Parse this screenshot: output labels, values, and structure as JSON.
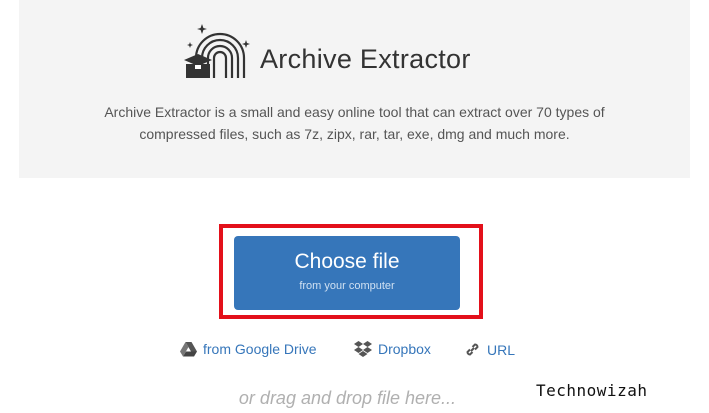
{
  "header": {
    "app_title": "Archive Extractor",
    "description_line1": "Archive Extractor is a small and easy online tool that can extract over 70 types of",
    "description_line2": "compressed files, such as 7z, zipx, rar, tar, exe, dmg and much more.",
    "logo_icon": "rainbow-box-icon"
  },
  "upload": {
    "choose_label": "Choose file",
    "choose_sublabel": "from your computer",
    "highlight_color": "#e3101a",
    "button_color": "#3676ba"
  },
  "sources": [
    {
      "label": "from Google Drive",
      "icon": "google-drive-icon"
    },
    {
      "label": "Dropbox",
      "icon": "dropbox-icon"
    },
    {
      "label": "URL",
      "icon": "link-icon"
    }
  ],
  "drop_hint": "or drag and drop file here...",
  "watermark": "Technowizah"
}
